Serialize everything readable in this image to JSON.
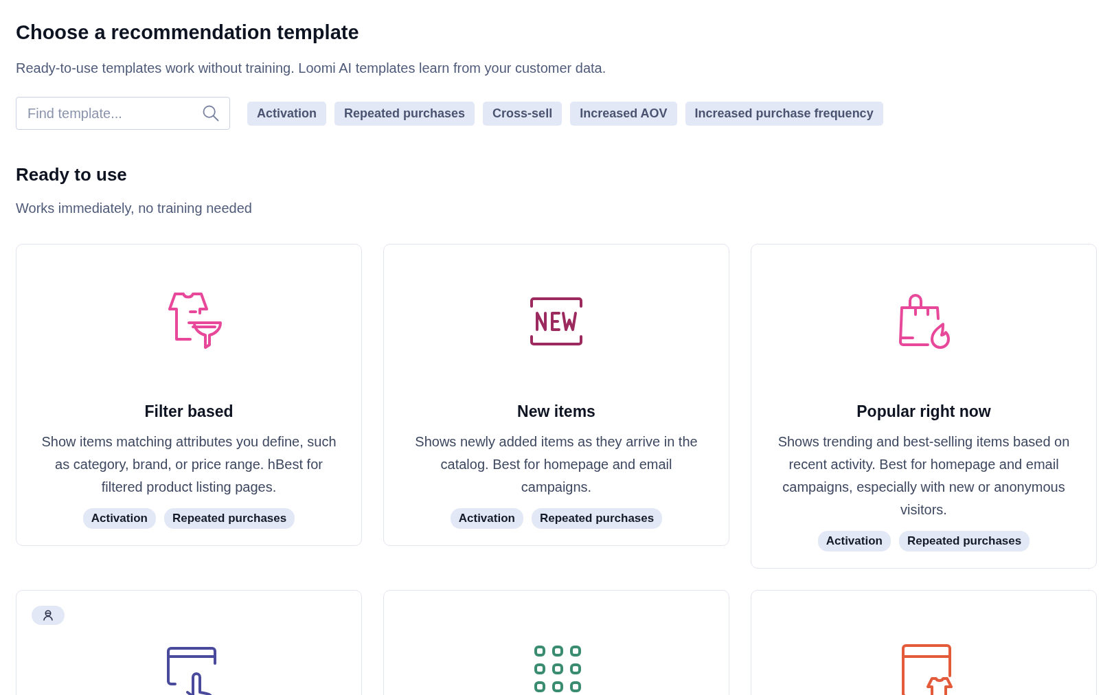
{
  "header": {
    "title": "Choose a recommendation template",
    "subtitle": "Ready-to-use templates work without training. Loomi AI templates learn from your customer data."
  },
  "search": {
    "placeholder": "Find template..."
  },
  "filters": [
    "Activation",
    "Repeated purchases",
    "Cross-sell",
    "Increased AOV",
    "Increased purchase frequency"
  ],
  "section": {
    "title": "Ready to use",
    "subtitle": "Works immediately, no training needed"
  },
  "cards": [
    {
      "title": "Filter based",
      "description": "Show items matching attributes you define, such as category, brand, or price range. hBest for filtered product listing pages.",
      "tags": [
        "Activation",
        "Repeated purchases"
      ],
      "color": "#e8489a",
      "badge": false
    },
    {
      "title": "New items",
      "description": "Shows newly added items as they arrive in the catalog. Best for homepage and email campaigns.",
      "tags": [
        "Activation",
        "Repeated purchases"
      ],
      "color": "#9c2a5e",
      "badge": false
    },
    {
      "title": "Popular right now",
      "description": "Shows trending and best-selling items based on recent activity. Best for homepage and email campaigns, especially with new or anonymous visitors.",
      "tags": [
        "Activation",
        "Repeated purchases"
      ],
      "color": "#e8489a",
      "badge": false
    },
    {
      "color": "#4a4a9c",
      "badge": true
    },
    {
      "color": "#3a8c70",
      "badge": false
    },
    {
      "color": "#e35b3a",
      "badge": false
    }
  ]
}
